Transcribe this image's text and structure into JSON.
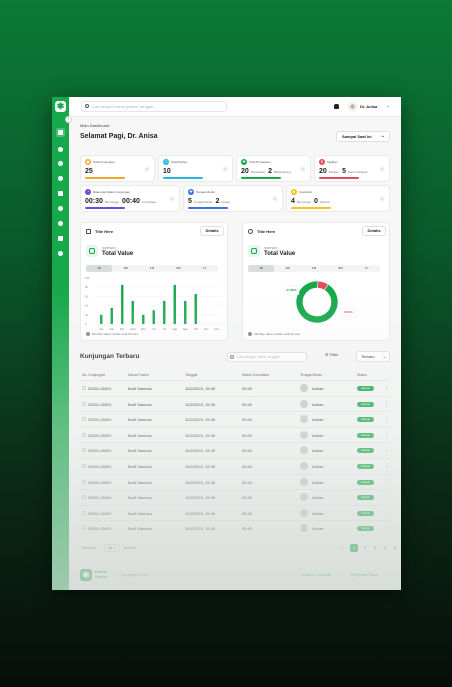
{
  "topbar": {
    "search_placeholder": "Cari dengan nama pasien, tanggal...",
    "user_name": "Dr. Anisa"
  },
  "main": {
    "breadcrumb": "Main Dashboard",
    "greeting": "Selamat Pagi, Dr. Anisa",
    "period": "Sampai Saat Ini"
  },
  "stats": [
    {
      "label": "Total Kunjungan",
      "value": "25",
      "color": "#f5a623",
      "icon": "calendar-icon"
    },
    {
      "label": "Total Pasien",
      "value": "10",
      "color": "#2bb6e6",
      "icon": "users-icon"
    },
    {
      "label": "Total Perawatan",
      "value": "20",
      "sub1": "Perawatan",
      "value2": "2",
      "sub2": "Berlangsung",
      "color": "#17a84b",
      "icon": "stethoscope-icon"
    },
    {
      "label": "Tagihan",
      "value": "20",
      "sub1": "Dibayar",
      "value2": "5",
      "sub2": "Belum Dibayar",
      "color": "#e5495c",
      "icon": "invoice-icon"
    },
    {
      "label": "Rata-rata Waktu Kunjungan",
      "value": "00:30",
      "sub1": "Menunggu",
      "value2": "00:40",
      "sub2": "Konsultasi",
      "color": "#6c4ce0",
      "icon": "clock-icon"
    },
    {
      "label": "Tenaga Medis",
      "value": "5",
      "sub1": "Tenaga Medis",
      "value2": "2",
      "sub2": "Dokter",
      "color": "#3b6fe0",
      "icon": "doctor-icon"
    },
    {
      "label": "Inventaris",
      "value": "4",
      "sub1": "Menunggu",
      "value2": "0",
      "sub2": "Selesai",
      "color": "#f5c518",
      "icon": "box-icon"
    }
  ],
  "panels": [
    {
      "title": "Title Here",
      "details": "Details",
      "subtitle": "SUBTEXT",
      "total": "Total Value",
      "note": "Monthly value include until 0 hours",
      "tabs": [
        "1D",
        "1W",
        "1M",
        "6M",
        "1Y"
      ]
    },
    {
      "title": "Title Here",
      "details": "Details",
      "subtitle": "SUBTEXT",
      "total": "Total Value",
      "note": "Monthly value include until 0 hours",
      "tabs": [
        "1D",
        "1W",
        "1M",
        "6M",
        "1Y"
      ]
    }
  ],
  "chart_data": [
    {
      "type": "bar",
      "categories": [
        "Jan",
        "Feb",
        "Mar",
        "April",
        "Mei",
        "Jun",
        "Jul",
        "Agu",
        "Sep",
        "Okt",
        "Nov",
        "Des"
      ],
      "values": [
        20,
        35,
        85,
        50,
        20,
        30,
        50,
        85,
        50,
        65,
        0,
        0
      ],
      "ylim": [
        0,
        100
      ],
      "yticks": [
        "100",
        "80",
        "60",
        "40",
        "20",
        "0"
      ],
      "color": "#17a84b"
    },
    {
      "type": "pie",
      "categories": [
        "Green",
        "Red"
      ],
      "values": [
        91.88,
        8.12
      ],
      "labels": [
        "91.88%",
        "8.12%"
      ],
      "colors": [
        "#17a84b",
        "#e5495c"
      ]
    }
  ],
  "table": {
    "title": "Kunjungan Terbaru",
    "search_placeholder": "Cari dengan nama, tanggal...",
    "filter_label": "Filter",
    "sort_label": "Terbaru",
    "headers": [
      "No. Kunjungan",
      "Nama Pasien",
      "Tanggal",
      "Waktu Konsultasi",
      "Tenaga Medis",
      "Status"
    ],
    "rows": [
      {
        "no": "20001-00001",
        "name": "Budi Santoso",
        "date": "10/2/2023, 15:45",
        "time": "00:40",
        "medic": "Adrian",
        "status": "Selesai"
      },
      {
        "no": "20001-00001",
        "name": "Budi Santoso",
        "date": "10/2/2023, 15:45",
        "time": "00:40",
        "medic": "Adrian",
        "status": "Selesai"
      },
      {
        "no": "20001-00001",
        "name": "Budi Santoso",
        "date": "10/2/2023, 15:45",
        "time": "00:40",
        "medic": "Adrian",
        "status": "Selesai"
      },
      {
        "no": "20001-00001",
        "name": "Budi Santoso",
        "date": "10/2/2023, 15:45",
        "time": "00:40",
        "medic": "Adrian",
        "status": "Selesai"
      },
      {
        "no": "20001-00001",
        "name": "Budi Santoso",
        "date": "10/2/2023, 15:45",
        "time": "00:40",
        "medic": "Adrian",
        "status": "Selesai"
      },
      {
        "no": "20001-00001",
        "name": "Budi Santoso",
        "date": "10/2/2023, 15:45",
        "time": "00:40",
        "medic": "Adrian",
        "status": "Selesai"
      },
      {
        "no": "20001-00001",
        "name": "Budi Santoso",
        "date": "10/2/2023, 15:45",
        "time": "00:40",
        "medic": "Adrian",
        "status": "Selesai"
      },
      {
        "no": "20001-00001",
        "name": "Budi Santoso",
        "date": "10/2/2023, 15:45",
        "time": "00:40",
        "medic": "Adrian",
        "status": "Selesai"
      },
      {
        "no": "20001-00001",
        "name": "Budi Santoso",
        "date": "10/2/2023, 15:45",
        "time": "00:40",
        "medic": "Adrian",
        "status": "Selesai"
      },
      {
        "no": "20001-00001",
        "name": "Budi Santoso",
        "date": "10/2/2023, 15:45",
        "time": "00:40",
        "medic": "Adrian",
        "status": "Selesai"
      }
    ]
  },
  "pagination": {
    "showing": "Showing",
    "per_page": "10",
    "of_label": "from 80",
    "pages": [
      "1",
      "2",
      "3",
      "4",
      "5"
    ],
    "current": "1"
  },
  "footer": {
    "brand": "Health Center",
    "copyright": "Copyright © 2023",
    "link1": "Syarat & Ketentuan",
    "link2": "Kebijakan Privasi"
  }
}
